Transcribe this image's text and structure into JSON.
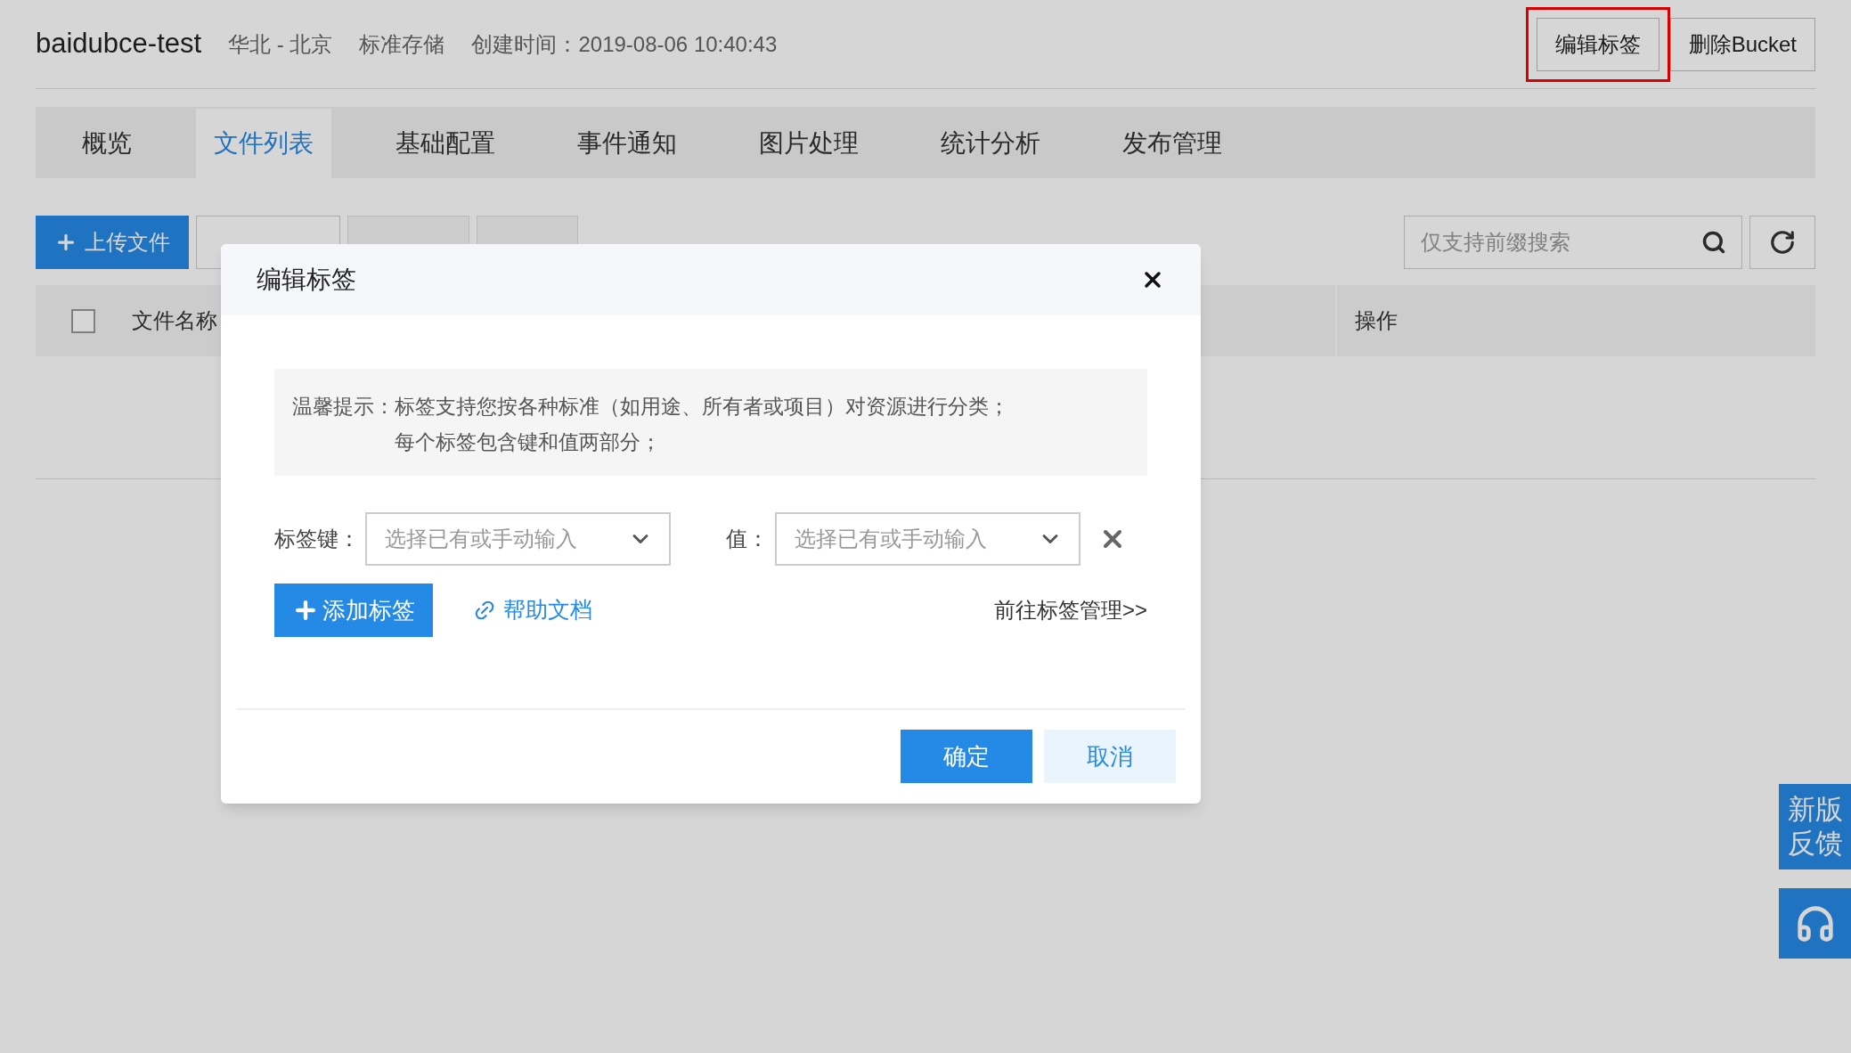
{
  "header": {
    "title": "baidubce-test",
    "meta": [
      "华北 - 北京",
      "标准存储",
      "创建时间：2019-08-06 10:40:43"
    ],
    "buttons": [
      {
        "label": "编辑标签",
        "highlighted": true
      },
      {
        "label": "删除Bucket",
        "highlighted": false
      }
    ]
  },
  "tabs": [
    {
      "label": "概览",
      "selected": false
    },
    {
      "label": "文件列表",
      "selected": true
    },
    {
      "label": "基础配置",
      "selected": false
    },
    {
      "label": "事件通知",
      "selected": false
    },
    {
      "label": "图片处理",
      "selected": false
    },
    {
      "label": "统计分析",
      "selected": false
    },
    {
      "label": "发布管理",
      "selected": false
    }
  ],
  "toolbar": {
    "buttons": [
      {
        "label": "上传文件",
        "kind": "primary"
      },
      {
        "kind": "default"
      },
      {
        "kind": "disabled"
      },
      {
        "kind": "disabled"
      }
    ],
    "search": {
      "placeholder": "仅支持前缀搜索"
    }
  },
  "table": {
    "select_all": {
      "checked": false
    },
    "columns": [
      "文件名称",
      "操作"
    ]
  },
  "modal": {
    "title": "编辑标签",
    "notice": {
      "label": "温馨提示：",
      "lines": [
        "标签支持您按各种标准（如用途、所有者或项目）对资源进行分类；",
        "每个标签包含键和值两部分；"
      ]
    },
    "key": {
      "label": "标签键：",
      "placeholder": "选择已有或手动输入"
    },
    "value": {
      "label": "值：",
      "placeholder": "选择已有或手动输入"
    },
    "add_button": "添加标签",
    "help_link": "帮助文档",
    "manage_link": "前往标签管理>>",
    "ok": "确定",
    "cancel": "取消"
  },
  "float": {
    "feedback": "新版反馈"
  }
}
